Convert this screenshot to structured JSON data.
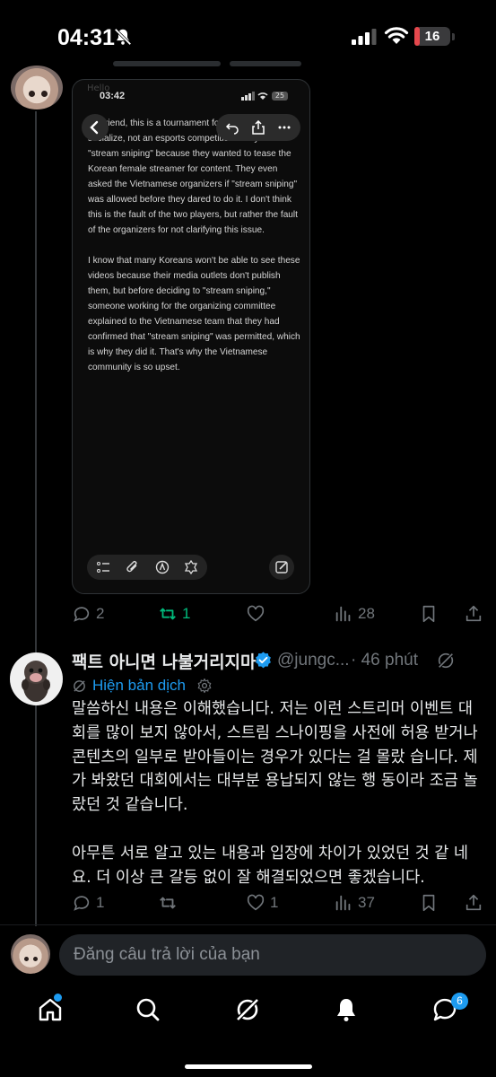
{
  "status_bar": {
    "time": "04:31",
    "battery_level": "16",
    "battery_fraction": 0.16
  },
  "embed": {
    "faded_text": "Hello",
    "time": "03:42",
    "battery": "25",
    "paragraphs": [
      "My friend, this is a tournament for streamers to socialize, not an esports competition. They used \"stream sniping\" because they wanted to tease the Korean female streamer for content. They even asked the Vietnamese organizers if \"stream sniping\" was allowed before they dared to do it. I don't think this is the fault of the two players, but rather the fault of the organizers for not clarifying this issue.",
      "I know that many Koreans won't be able to see these videos because their media outlets don't publish them, but before deciding to \"stream sniping,\" someone working for the organizing committee explained to the Vietnamese team that they had confirmed that \"stream sniping\" was permitted, which is why they did it. That's why the Vietnamese community is so upset."
    ]
  },
  "tweet1_actions": {
    "replies": "2",
    "reposts": "1",
    "likes": "",
    "views": "28"
  },
  "tweet2": {
    "name": "팩트 아니면 나불거리지마",
    "handle": "@jungc...",
    "time": "· 46 phút",
    "translate_label": "Hiện bản dịch",
    "paragraphs": [
      "말씀하신 내용은 이해했습니다. 저는 이런 스트리머 이벤트 대회를 많이 보지 않아서, 스트림 스나이핑을 사전에 허용 받거나 콘텐츠의 일부로 받아들이는 경우가 있다는 걸 몰랐 습니다. 제가 봐왔던 대회에서는 대부분 용납되지 않는 행 동이라 조금 놀랐던 것 같습니다.",
      "아무튼 서로 알고 있는 내용과 입장에 차이가 있었던 것 같 네요. 더 이상 큰 갈등 없이 잘 해결되었으면 좋겠습니다."
    ],
    "actions": {
      "replies": "1",
      "reposts": "",
      "likes": "1",
      "views": "37"
    }
  },
  "composer": {
    "placeholder": "Đăng câu trả lời của bạn"
  },
  "nav": {
    "messages_badge": "6"
  },
  "colors": {
    "accent": "#1d9bf0",
    "repost_active": "#00ba7c",
    "muted": "#71767b",
    "battery_low": "#e5484d"
  }
}
